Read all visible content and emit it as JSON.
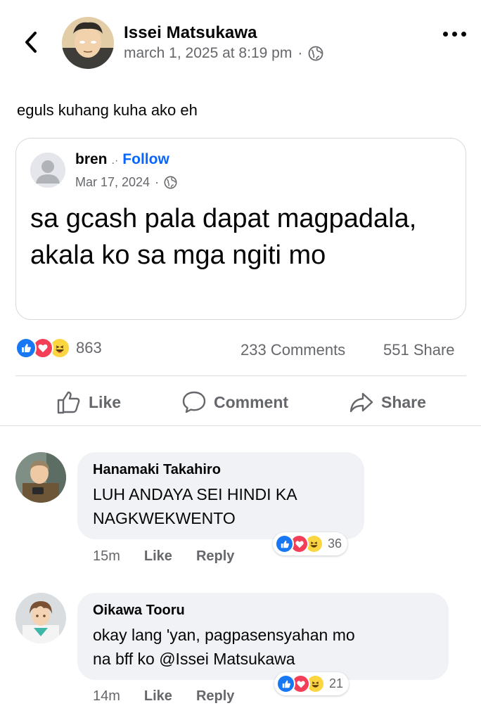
{
  "post": {
    "author": "Issei Matsukawa",
    "timestamp": "march 1, 2025 at 8:19 pm",
    "separator": "·",
    "audience_icon": "globe-icon",
    "text": "eguls kuhang kuha ako eh"
  },
  "shared_post": {
    "author": "bren",
    "author_suffix": ".·",
    "follow_label": "Follow",
    "date": "Mar 17, 2024",
    "separator": "·",
    "text": "sa gcash pala dapat magpadala, akala ko sa mga ngiti mo"
  },
  "stats": {
    "reactions": [
      "like",
      "love",
      "haha"
    ],
    "reaction_count": "863",
    "comments": "233 Comments",
    "shares": "551 Share"
  },
  "actions": {
    "like": "Like",
    "comment": "Comment",
    "share": "Share"
  },
  "comments": [
    {
      "author": "Hanamaki Takahiro",
      "text_lines": [
        "LUH ANDAYA SEI HINDI KA",
        "NAGKWEKWENTO"
      ],
      "time": "15m",
      "like": "Like",
      "reply": "Reply",
      "reaction_count": "36"
    },
    {
      "author": "Oikawa Tooru",
      "text_lines": [
        "okay lang 'yan, pagpasensyahan mo",
        "na bff ko @Issei Matsukawa"
      ],
      "time": "14m",
      "like": "Like",
      "reply": "Reply",
      "reaction_count": "21"
    }
  ],
  "colors": {
    "accent_blue": "#0866ff",
    "muted": "#65676b",
    "bubble": "#f0f2f5",
    "love": "#f33e58",
    "haha": "#fcd641"
  }
}
